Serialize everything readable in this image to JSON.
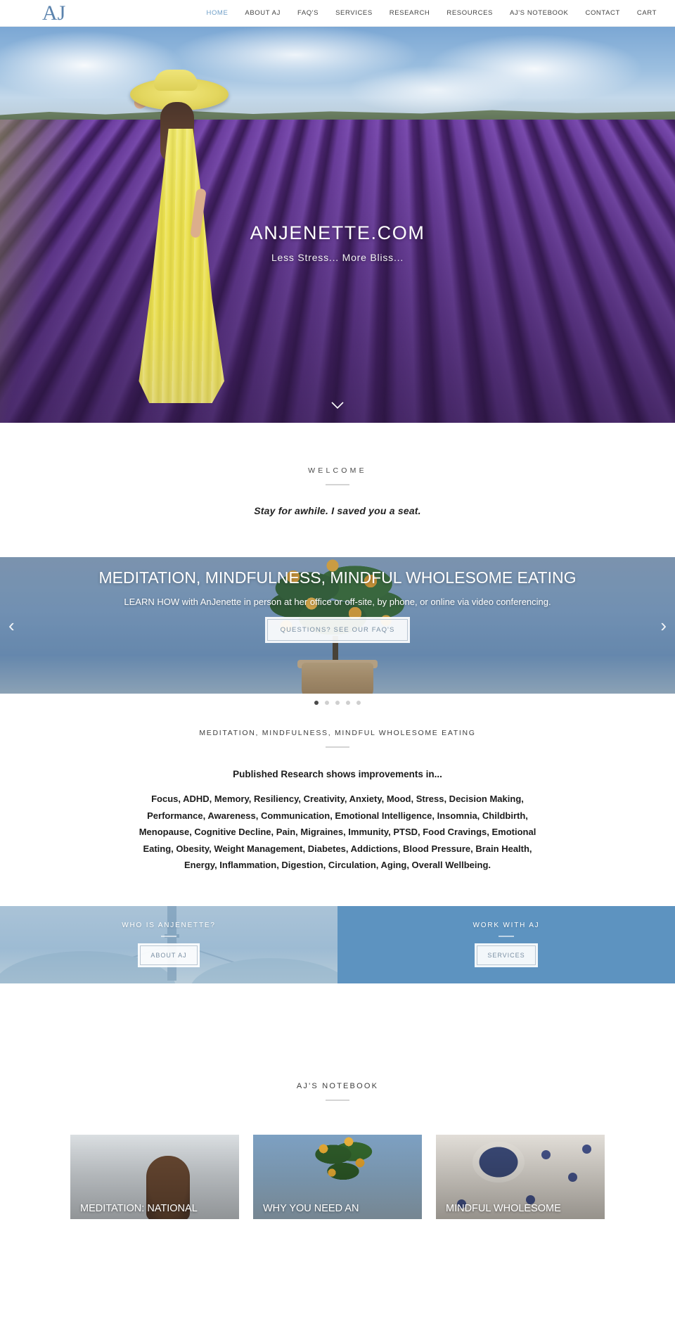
{
  "header": {
    "logo": "AJ",
    "nav": [
      {
        "label": "HOME",
        "active": true
      },
      {
        "label": "ABOUT AJ",
        "active": false
      },
      {
        "label": "FAQ'S",
        "active": false
      },
      {
        "label": "SERVICES",
        "active": false
      },
      {
        "label": "RESEARCH",
        "active": false
      },
      {
        "label": "RESOURCES",
        "active": false
      },
      {
        "label": "AJ'S NOTEBOOK",
        "active": false
      },
      {
        "label": "CONTACT",
        "active": false
      },
      {
        "label": "CART",
        "active": false
      }
    ]
  },
  "hero": {
    "title": "ANJENETTE.COM",
    "subtitle": "Less Stress... More Bliss...",
    "scroll_icon": "chevron-down-icon"
  },
  "welcome": {
    "eyebrow": "WELCOME",
    "tagline": "Stay for awhile. I saved you a seat."
  },
  "carousel": {
    "title": "MEDITATION, MINDFULNESS, MINDFUL WHOLESOME EATING",
    "subtitle": "LEARN HOW with AnJenette in person at her office or off-site, by phone, or online via video conferencing.",
    "button": "QUESTIONS? SEE OUR FAQ'S",
    "prev_icon": "chevron-left-icon",
    "next_icon": "chevron-right-icon",
    "prev_glyph": "‹",
    "next_glyph": "›",
    "slide_count": 5,
    "active_slide": 1
  },
  "research": {
    "eyebrow": "MEDITATION, MINDFULNESS, MINDFUL WHOLESOME EATING",
    "heading": "Published Research shows improvements in...",
    "body": "Focus, ADHD, Memory, Resiliency, Creativity, Anxiety, Mood, Stress, Decision Making, Performance, Awareness, Communication, Emotional Intelligence, Insomnia, Childbirth, Menopause, Cognitive Decline, Pain, Migraines, Immunity, PTSD, Food Cravings, Emotional Eating, Obesity, Weight Management, Diabetes, Addictions, Blood Pressure, Brain Health, Energy, Inflammation, Digestion, Circulation, Aging, Overall Wellbeing."
  },
  "panels": [
    {
      "eyebrow": "WHO IS ANJENETTE?",
      "button": "ABOUT AJ"
    },
    {
      "eyebrow": "WORK WITH AJ",
      "button": "SERVICES"
    }
  ],
  "notebook": {
    "eyebrow": "AJ'S NOTEBOOK",
    "cards": [
      {
        "title": "MEDITATION: NATIONAL"
      },
      {
        "title": "WHY YOU NEED AN"
      },
      {
        "title": "MINDFUL WHOLESOME"
      }
    ]
  },
  "colors": {
    "logo": "#5b83ad",
    "nav_active": "#6f9fc8",
    "panel_blue": "#5d93c0",
    "button_text": "#7a8fa3"
  }
}
